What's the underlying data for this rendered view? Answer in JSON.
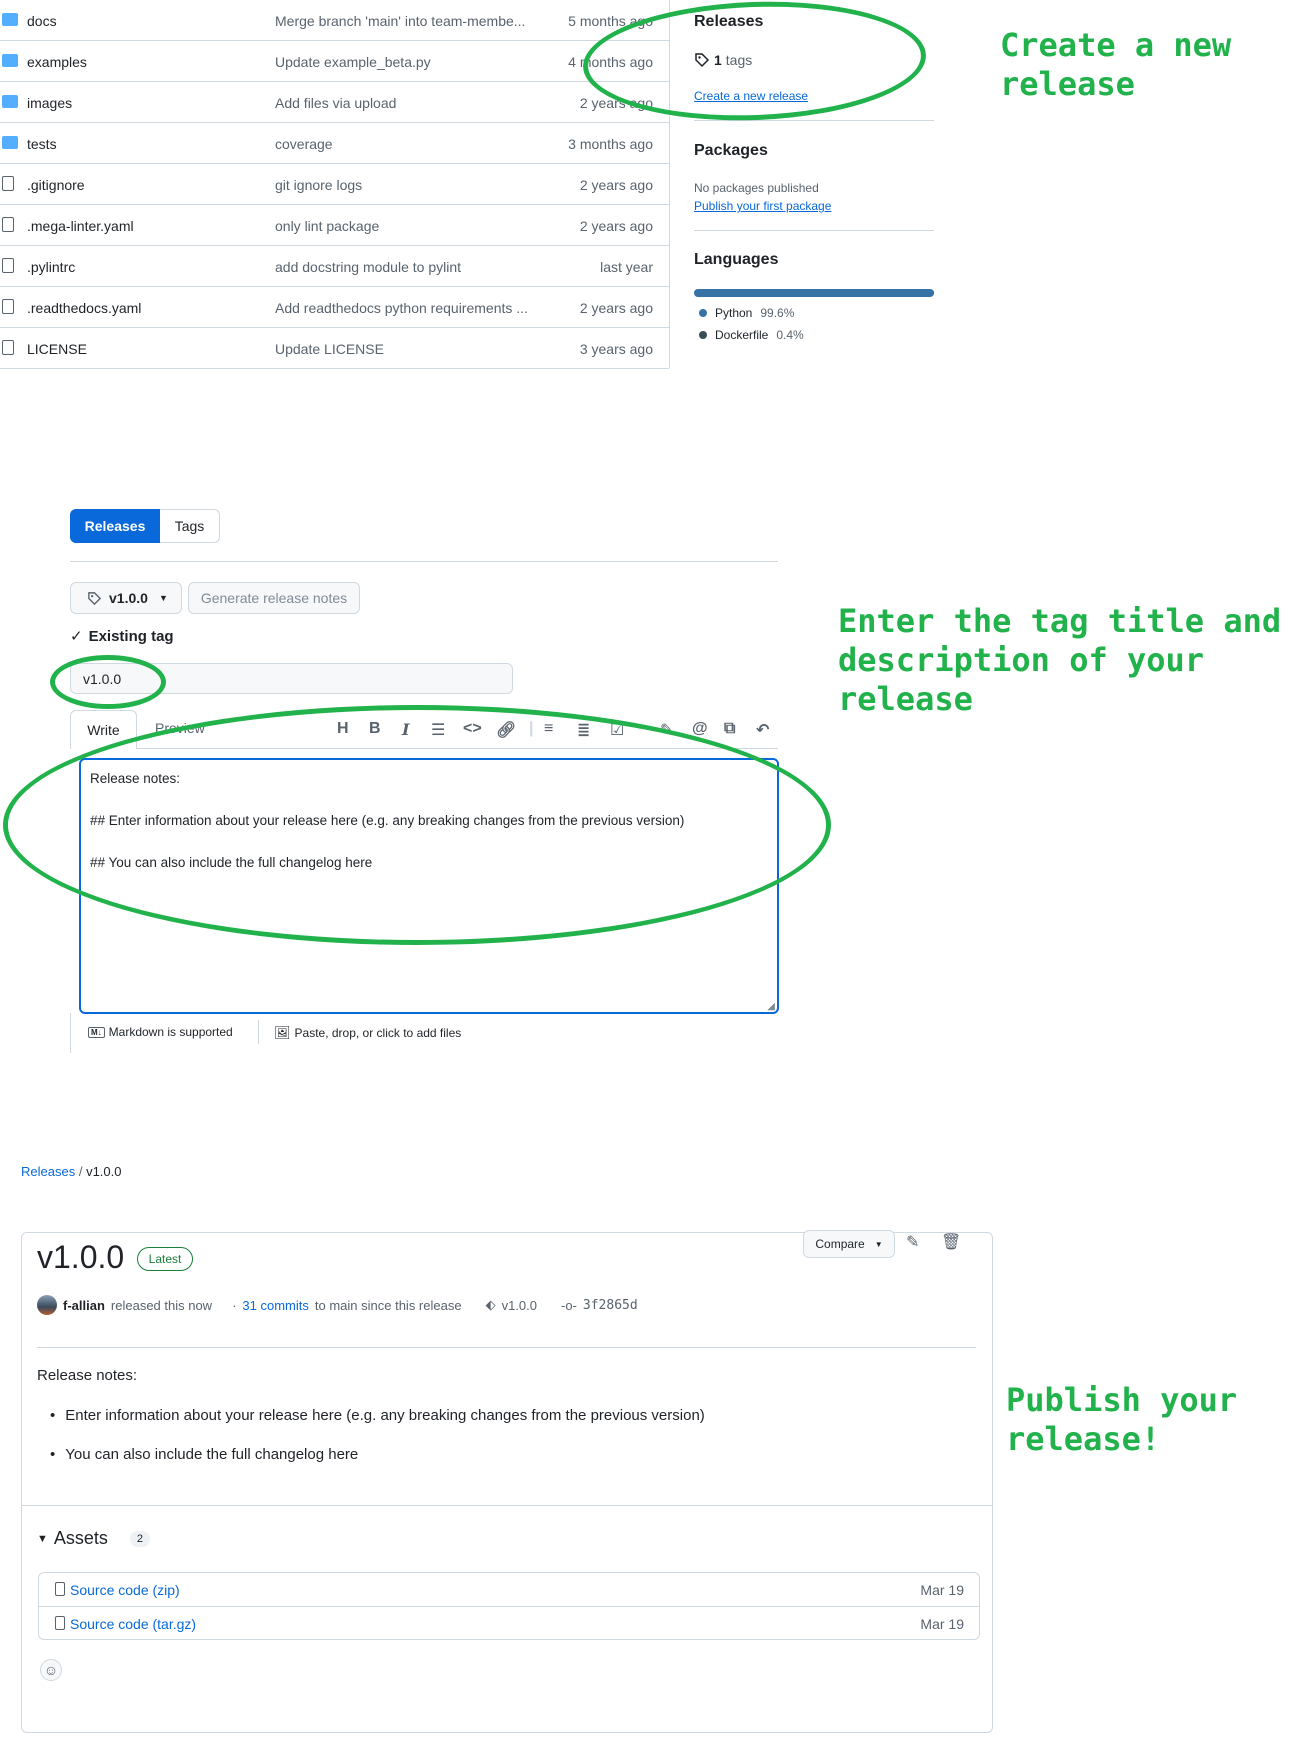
{
  "files": [
    {
      "name": "docs",
      "type": "folder",
      "message": "Merge branch 'main' into team-membe...",
      "date": "5 months ago"
    },
    {
      "name": "examples",
      "type": "folder",
      "message": "Update example_beta.py",
      "date": "4 months ago"
    },
    {
      "name": "images",
      "type": "folder",
      "message": "Add files via upload",
      "date": "2 years ago"
    },
    {
      "name": "tests",
      "type": "folder",
      "message": "coverage",
      "date": "3 months ago"
    },
    {
      "name": ".gitignore",
      "type": "file",
      "message": "git ignore logs",
      "date": "2 years ago"
    },
    {
      "name": ".mega-linter.yaml",
      "type": "file",
      "message": "only lint package",
      "date": "2 years ago"
    },
    {
      "name": ".pylintrc",
      "type": "file",
      "message": "add docstring module to pylint",
      "date": "last year"
    },
    {
      "name": ".readthedocs.yaml",
      "type": "file",
      "message": "Add readthedocs python requirements ...",
      "date": "2 years ago"
    },
    {
      "name": "LICENSE",
      "type": "file",
      "message": "Update LICENSE",
      "date": "3 years ago"
    }
  ],
  "sidebar": {
    "releases_heading": "Releases",
    "tags_count": "1",
    "tags_label": "tags",
    "create_release_link": "Create a new release",
    "packages_heading": "Packages",
    "no_packages": "No packages published",
    "publish_package_link": "Publish your first package",
    "languages_heading": "Languages",
    "languages": [
      {
        "name": "Python",
        "percent": "99.6%",
        "share": 0.996,
        "color": "#3572A5"
      },
      {
        "name": "Dockerfile",
        "percent": "0.4%",
        "share": 0.004,
        "color": "#384d54"
      }
    ]
  },
  "annotations": {
    "step1": [
      "Create a new",
      "release"
    ],
    "step2": [
      "Enter the tag title and",
      "description of your",
      "release"
    ],
    "step3": [
      "Publish your",
      "release!"
    ]
  },
  "editor": {
    "tabs": {
      "releases": "Releases",
      "tags": "Tags"
    },
    "tag_button": "v1.0.0",
    "generate_notes": "Generate release notes",
    "existing_tag": "Existing tag",
    "title_value": "v1.0.0",
    "write_tab": "Write",
    "preview_tab": "Preview",
    "body_lines": [
      "Release notes:",
      "## Enter information about your release here (e.g. any breaking changes from the previous version)",
      "## You can also include the full changelog here"
    ],
    "markdown_note": "Markdown is supported",
    "attach_note": "Paste, drop, or click to add files"
  },
  "release": {
    "breadcrumb_root": "Releases",
    "breadcrumb_sep": "/",
    "breadcrumb_current": "v1.0.0",
    "title": "v1.0.0",
    "badge": "Latest",
    "compare_label": "Compare",
    "author": "f-allian",
    "released_text": "released this now",
    "commits_link": "31 commits",
    "commits_rest": "to main since this release",
    "tag": "v1.0.0",
    "commit_sha": "3f2865d",
    "notes_heading": "Release notes:",
    "bullets": [
      "Enter information about your release here (e.g. any breaking changes from the previous version)",
      "You can also include the full changelog here"
    ],
    "assets_heading": "Assets",
    "assets_count": "2",
    "assets": [
      {
        "name": "Source code",
        "ext": "(zip)",
        "date": "Mar 19"
      },
      {
        "name": "Source code",
        "ext": "(tar.gz)",
        "date": "Mar 19"
      }
    ]
  }
}
